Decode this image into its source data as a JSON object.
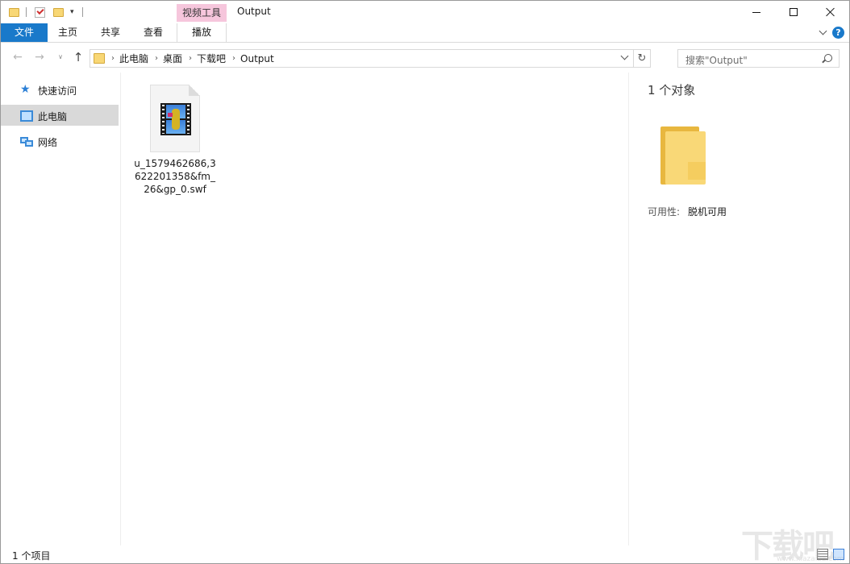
{
  "quick_access": {
    "icons": [
      "folder-icon",
      "properties-icon",
      "new-folder-icon",
      "customize-arrow-icon"
    ]
  },
  "title_bar": {
    "context_tab_header": "视频工具",
    "window_title": "Output"
  },
  "ribbon": {
    "tabs": [
      {
        "label": "文件"
      },
      {
        "label": "主页"
      },
      {
        "label": "共享"
      },
      {
        "label": "查看"
      },
      {
        "label": "播放"
      }
    ],
    "help": "?"
  },
  "address_bar": {
    "crumbs": [
      "此电脑",
      "桌面",
      "下载吧",
      "Output"
    ],
    "separator": "›"
  },
  "search": {
    "placeholder": "搜索\"Output\""
  },
  "nav_pane": {
    "items": [
      {
        "label": "快速访问",
        "icon": "star-icon"
      },
      {
        "label": "此电脑",
        "icon": "computer-icon",
        "selected": true
      },
      {
        "label": "网络",
        "icon": "network-icon"
      }
    ]
  },
  "files": [
    {
      "name": "u_1579462686,3622201358&fm_26&gp_0.swf",
      "icon": "swf-video-file-icon"
    }
  ],
  "details": {
    "title": "1 个对象",
    "availability_label": "可用性:",
    "availability_value": "脱机可用"
  },
  "status_bar": {
    "text": "1 个项目"
  },
  "watermark": {
    "sub": "www.xiazaiba.com"
  },
  "colors": {
    "file_tab": "#1979ca",
    "context_tab": "#f6c6dc",
    "selection": "#d9d9d9",
    "folder": "#f9d877"
  }
}
